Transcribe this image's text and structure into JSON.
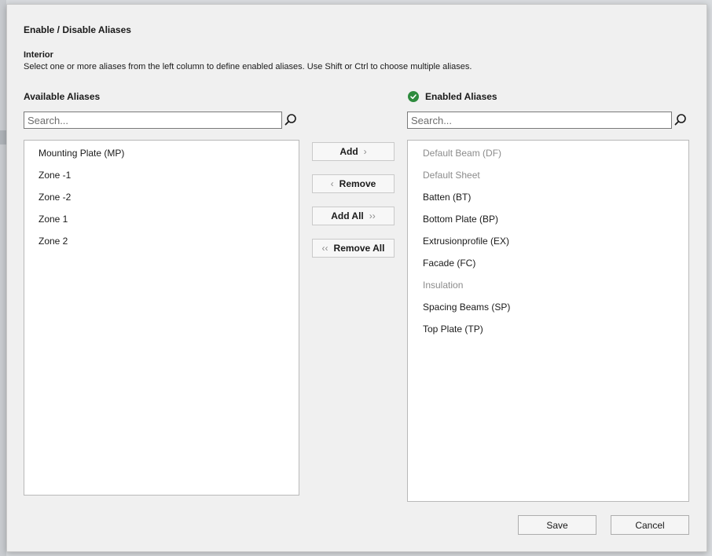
{
  "dialog": {
    "title": "Enable / Disable Aliases",
    "subtitle": "Interior",
    "instructions": "Select one or more aliases from the left column to define enabled aliases. Use Shift or Ctrl to choose multiple aliases."
  },
  "available": {
    "header": "Available Aliases",
    "search_placeholder": "Search...",
    "items": [
      {
        "label": "Mounting Plate (MP)",
        "enabled": true
      },
      {
        "label": "Zone -1",
        "enabled": true
      },
      {
        "label": "Zone -2",
        "enabled": true
      },
      {
        "label": "Zone 1",
        "enabled": true
      },
      {
        "label": "Zone 2",
        "enabled": true
      }
    ]
  },
  "enabled": {
    "header": "Enabled Aliases",
    "header_icon": "check-circle-icon",
    "search_placeholder": "Search...",
    "items": [
      {
        "label": "Default Beam (DF)",
        "enabled": false
      },
      {
        "label": "Default Sheet",
        "enabled": false
      },
      {
        "label": "Batten (BT)",
        "enabled": true
      },
      {
        "label": "Bottom Plate (BP)",
        "enabled": true
      },
      {
        "label": "Extrusionprofile (EX)",
        "enabled": true
      },
      {
        "label": "Facade (FC)",
        "enabled": true
      },
      {
        "label": "Insulation",
        "enabled": false
      },
      {
        "label": "Spacing Beams (SP)",
        "enabled": true
      },
      {
        "label": "Top Plate (TP)",
        "enabled": true
      }
    ]
  },
  "transfer": {
    "add_label": "Add",
    "add_chevron": "›",
    "remove_label": "Remove",
    "remove_chevron": "‹",
    "add_all_label": "Add All",
    "add_all_chevron": "››",
    "remove_all_label": "Remove All",
    "remove_all_chevron": "‹‹"
  },
  "footer": {
    "save_label": "Save",
    "cancel_label": "Cancel"
  },
  "colors": {
    "accent_check": "#2e8b3e",
    "disabled_text": "#8c8c8c",
    "dialog_bg": "#f0f0f0"
  }
}
